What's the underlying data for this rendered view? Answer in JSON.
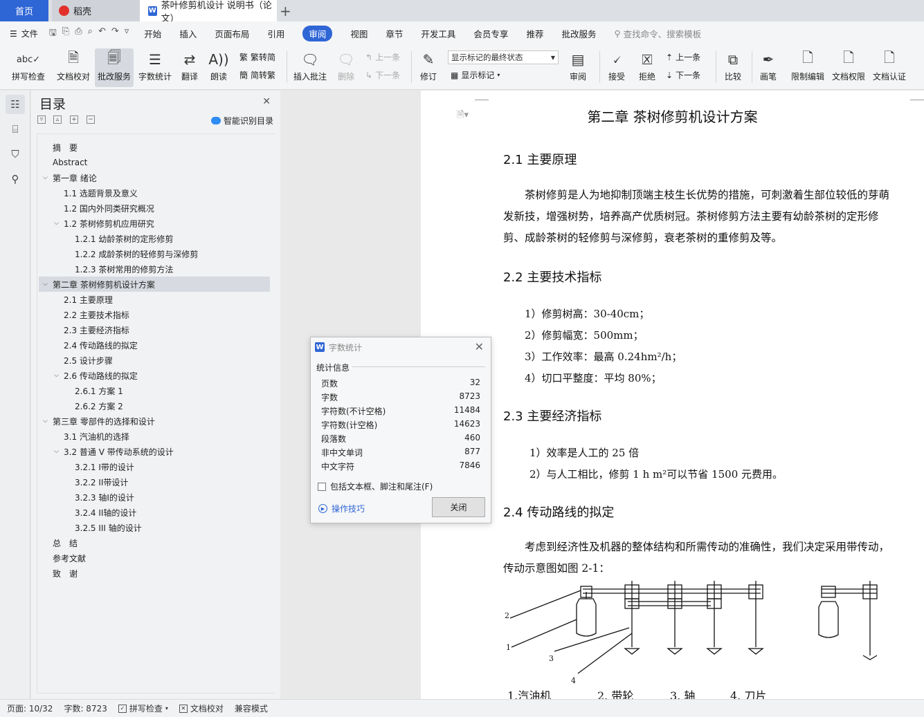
{
  "tabs": {
    "home": "首页",
    "daoke": "稻壳",
    "doc": "茶叶修剪机设计 说明书（论文）"
  },
  "menu": {
    "file": "文件",
    "items": [
      "开始",
      "插入",
      "页面布局",
      "引用",
      "审阅",
      "视图",
      "章节",
      "开发工具",
      "会员专享",
      "推荐",
      "批改服务"
    ],
    "active": "审阅",
    "search": "查找命令、搜索模板"
  },
  "ribbon": {
    "spell": "拼写检查",
    "proofread": "文档校对",
    "correction": "批改服务",
    "wordcount": "字数统计",
    "translate": "翻译",
    "read": "朗读",
    "to_trad": "繁转简",
    "to_simp": "简转繁",
    "insert_comment": "插入批注",
    "delete": "删除",
    "prev_comment": "上一条",
    "next_comment": "下一条",
    "track": "修订",
    "markup_state": "显示标记的最终状态",
    "show_markup": "显示标记",
    "review": "审阅",
    "accept": "接受",
    "reject": "拒绝",
    "prev_change": "上一条",
    "next_change": "下一条",
    "compare": "比较",
    "pen": "画笔",
    "restrict": "限制编辑",
    "permission": "文档权限",
    "certify": "文档认证"
  },
  "toc": {
    "title": "目录",
    "ai": "智能识别目录",
    "items": [
      {
        "label": "摘　要",
        "level": 0,
        "arrow": ""
      },
      {
        "label": "Abstract",
        "level": 0,
        "arrow": ""
      },
      {
        "label": "第一章  绪论",
        "level": 0,
        "arrow": "v"
      },
      {
        "label": "1.1 选题背景及意义",
        "level": 1,
        "arrow": ""
      },
      {
        "label": "1.2 国内外同类研究概况",
        "level": 1,
        "arrow": ""
      },
      {
        "label": "1.2 茶树修剪机应用研究",
        "level": 1,
        "arrow": "v"
      },
      {
        "label": "1.2.1 幼龄茶树的定形修剪",
        "level": 2,
        "arrow": ""
      },
      {
        "label": "1.2.2 成龄茶树的轻修剪与深修剪",
        "level": 2,
        "arrow": ""
      },
      {
        "label": "1.2.3 茶树常用的修剪方法",
        "level": 2,
        "arrow": ""
      },
      {
        "label": "第二章  茶树修剪机设计方案",
        "level": 0,
        "arrow": "v"
      },
      {
        "label": "2.1 主要原理",
        "level": 1,
        "arrow": ""
      },
      {
        "label": "2.2 主要技术指标",
        "level": 1,
        "arrow": ""
      },
      {
        "label": "2.3 主要经济指标",
        "level": 1,
        "arrow": ""
      },
      {
        "label": "2.4 传动路线的拟定",
        "level": 1,
        "arrow": ""
      },
      {
        "label": "2.5 设计步骤",
        "level": 1,
        "arrow": ""
      },
      {
        "label": "2.6 传动路线的拟定",
        "level": 1,
        "arrow": "v"
      },
      {
        "label": "2.6.1 方案 1",
        "level": 2,
        "arrow": ""
      },
      {
        "label": "2.6.2 方案 2",
        "level": 2,
        "arrow": ""
      },
      {
        "label": "第三章  零部件的选择和设计",
        "level": 0,
        "arrow": "v"
      },
      {
        "label": "3.1 汽油机的选择",
        "level": 1,
        "arrow": ""
      },
      {
        "label": "3.2 普通 V 带传动系统的设计",
        "level": 1,
        "arrow": "v"
      },
      {
        "label": "3.2.1 I带的设计",
        "level": 2,
        "arrow": ""
      },
      {
        "label": "3.2.2 II带设计",
        "level": 2,
        "arrow": ""
      },
      {
        "label": "3.2.3 轴I的设计",
        "level": 2,
        "arrow": ""
      },
      {
        "label": "3.2.4 II轴的设计",
        "level": 2,
        "arrow": ""
      },
      {
        "label": "3.2.5 III  轴的设计",
        "level": 2,
        "arrow": ""
      },
      {
        "label": "总　结",
        "level": 0,
        "arrow": ""
      },
      {
        "label": "参考文献",
        "level": 0,
        "arrow": ""
      },
      {
        "label": "致　谢",
        "level": 0,
        "arrow": ""
      }
    ],
    "selected_index": 9
  },
  "doc": {
    "chapter": "第二章  茶树修剪机设计方案",
    "s21": "2.1 主要原理",
    "p21": "茶树修剪是人为地抑制顶端主枝生长优势的措施，可刺激着生部位较低的芽萌发新技，增强树势，培养高产优质树冠。茶树修剪方法主要有幼龄茶树的定形修剪、成龄茶树的轻修剪与深修剪，衰老茶树的重修剪及等。",
    "s22": "2.2 主要技术指标",
    "spec": [
      "1）修剪树高：30-40cm；",
      "2）修剪幅宽：500mm；",
      "3）工作效率：最高 0.24hm²/h；",
      "4）切口平整度：平均 80%；"
    ],
    "s23": "2.3 主要经济指标",
    "econ": [
      "1）效率是人工的 25 倍",
      "2）与人工相比，修剪 1 h m²可以节省 1500 元费用。"
    ],
    "s24": "2.4 传动路线的拟定",
    "p24": "考虑到经济性及机器的整体结构和所需传动的准确性，我们决定采用带传动，传动示意图如图 2-1：",
    "fig_nums": [
      "2",
      "1",
      "3",
      "4"
    ],
    "fig_labels": [
      "1.汽油机",
      "2. 带轮",
      "3. 轴",
      "4. 刀片"
    ]
  },
  "dialog": {
    "title": "字数统计",
    "section": "统计信息",
    "stats": [
      {
        "label": "页数",
        "value": "32"
      },
      {
        "label": "字数",
        "value": "8723"
      },
      {
        "label": "字符数(不计空格)",
        "value": "11484"
      },
      {
        "label": "字符数(计空格)",
        "value": "14623"
      },
      {
        "label": "段落数",
        "value": "460"
      },
      {
        "label": "非中文单词",
        "value": "877"
      },
      {
        "label": "中文字符",
        "value": "7846"
      }
    ],
    "include": "包括文本框、脚注和尾注(F)",
    "tips": "操作技巧",
    "close": "关闭"
  },
  "status": {
    "page": "页面: 10/32",
    "words": "字数: 8723",
    "spell": "拼写检查",
    "proof": "文档校对",
    "compat": "兼容模式"
  },
  "colors": {
    "accent": "#2f66d6"
  }
}
